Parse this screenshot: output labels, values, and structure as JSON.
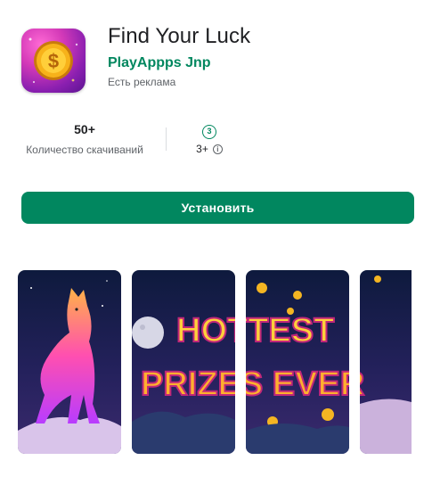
{
  "app": {
    "title": "Find Your Luck",
    "developer": "PlayAppps Jnp",
    "ads_notice": "Есть реклама"
  },
  "stats": {
    "downloads_value": "50+",
    "downloads_label": "Количество скачиваний",
    "rating_badge": "3",
    "rating_value": "3+",
    "info_glyph": "i"
  },
  "install": {
    "label": "Установить"
  },
  "screenshots": {
    "banner_line_1": "HOTTEST",
    "banner_line_2": "PRIZES EVER"
  },
  "colors": {
    "accent": "#01875f",
    "text": "#202124",
    "muted": "#5f6368"
  },
  "icons": [
    "coin-icon",
    "info-icon",
    "age-rating-icon"
  ]
}
